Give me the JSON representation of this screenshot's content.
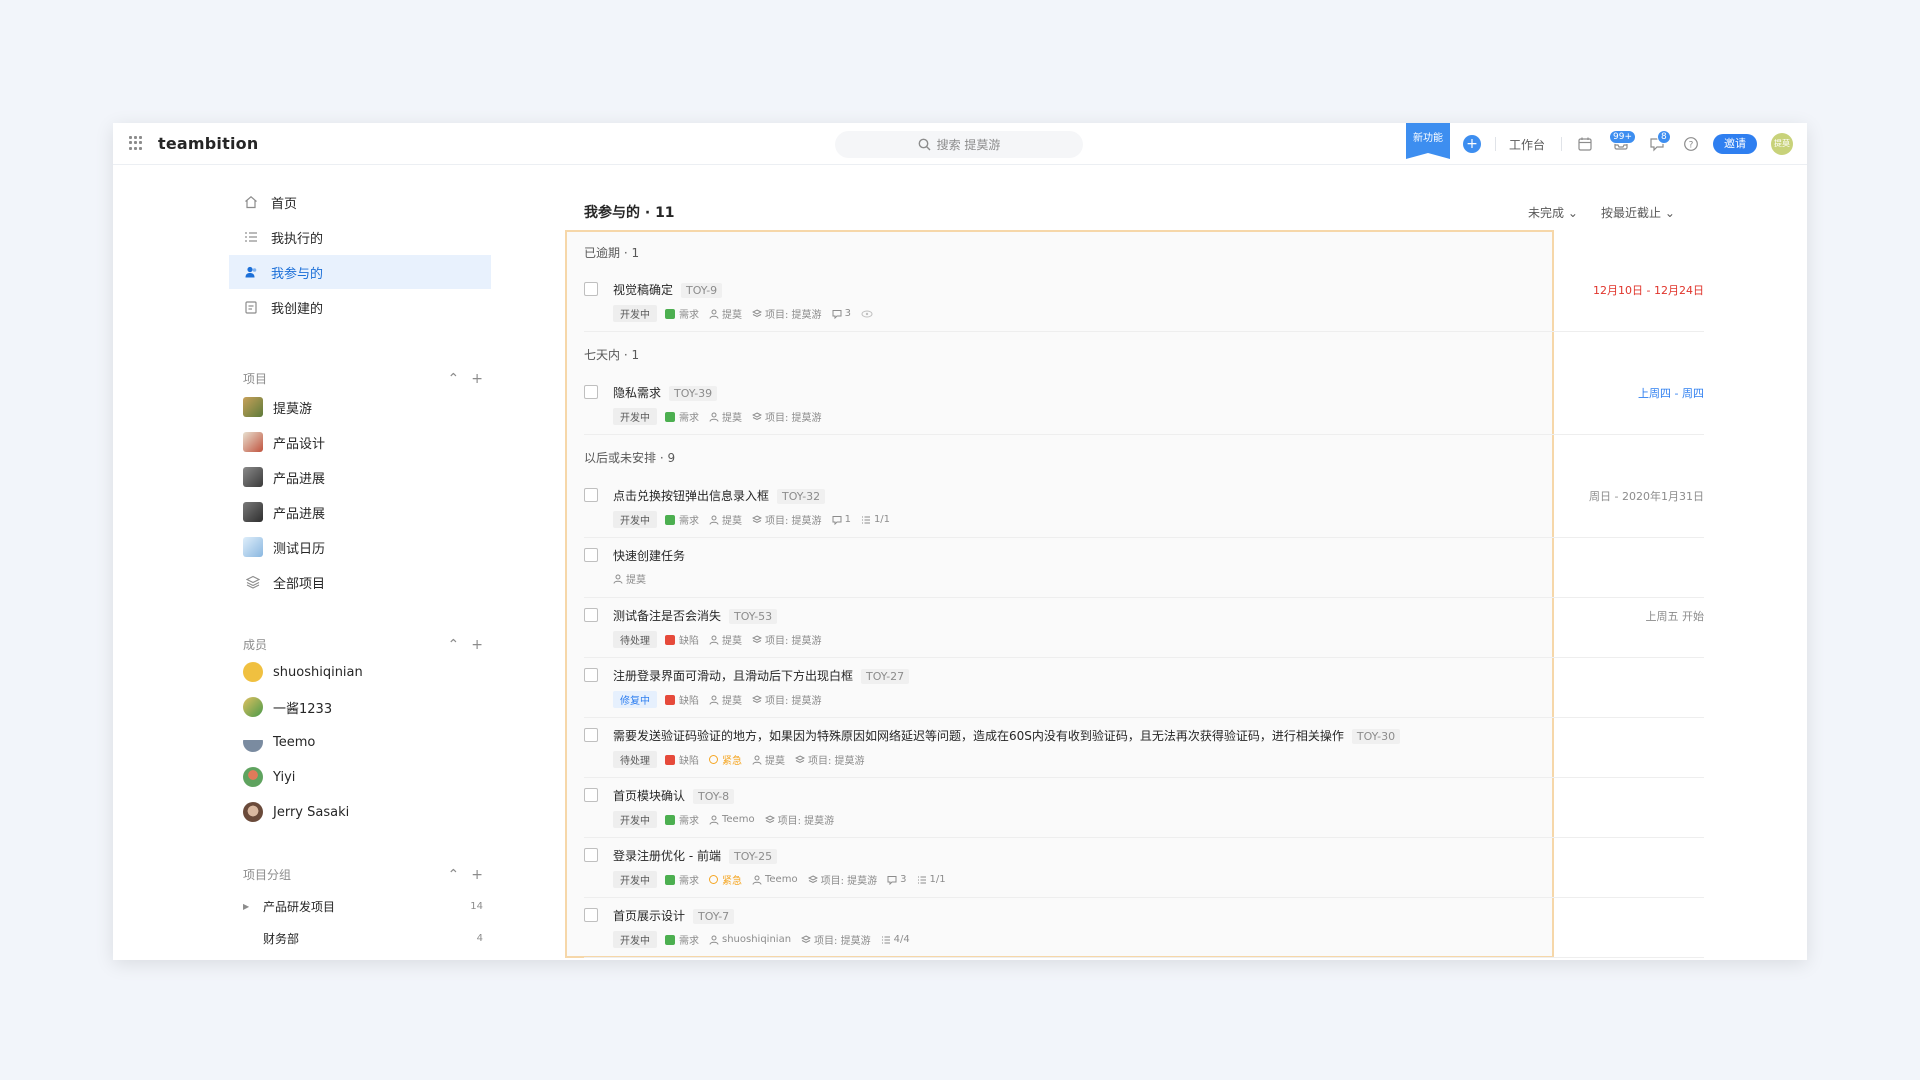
{
  "app": {
    "logo": "teambition",
    "search_placeholder": "搜索 提莫游",
    "new_feature": "新功能",
    "workbench": "工作台",
    "notif_badge": "99+",
    "msg_badge": "8",
    "invite": "邀请",
    "user_initials": "提莫"
  },
  "sidebar": {
    "nav": [
      {
        "label": "首页",
        "icon": "home-icon"
      },
      {
        "label": "我执行的",
        "icon": "list-icon"
      },
      {
        "label": "我参与的",
        "icon": "participant-icon",
        "active": true
      },
      {
        "label": "我创建的",
        "icon": "created-icon"
      }
    ],
    "projects_header": "项目",
    "projects": [
      {
        "label": "提莫游",
        "color": "#8a6d3b"
      },
      {
        "label": "产品设计",
        "color": "#c0533e"
      },
      {
        "label": "产品进展",
        "color": "#5b5b5b"
      },
      {
        "label": "产品进展",
        "color": "#4a4a4a"
      },
      {
        "label": "测试日历",
        "color": "#9fc5e8"
      },
      {
        "label": "全部项目",
        "color": ""
      }
    ],
    "members_header": "成员",
    "members": [
      {
        "label": "shuoshiqinian",
        "color": "#f0c040"
      },
      {
        "label": "一酱1233",
        "color": "#7cb36b"
      },
      {
        "label": "Teemo",
        "color": "#7a8ba0"
      },
      {
        "label": "Yiyi",
        "color": "#5fa35f"
      },
      {
        "label": "Jerry Sasaki",
        "color": "#8c6a5a"
      }
    ],
    "groups_header": "项目分组",
    "groups": [
      {
        "label": "产品研发项目",
        "count": "14"
      },
      {
        "label": "财务部",
        "count": "4"
      }
    ]
  },
  "main": {
    "title": "我参与的 · 11",
    "filter_status": "未完成",
    "filter_sort": "按最近截止",
    "groups": [
      {
        "label": "已逾期 · 1"
      },
      {
        "label": "七天内 · 1"
      },
      {
        "label": "以后或未安排 · 9"
      }
    ],
    "tasks": [
      {
        "title": "视觉稿确定",
        "id": "TOY-9",
        "status": "开发中",
        "type": "需求",
        "assignee": "提莫",
        "project": "项目: 提莫游",
        "comments": "3",
        "date": "12月10日 - 12月24日"
      },
      {
        "title": "隐私需求",
        "id": "TOY-39",
        "status": "开发中",
        "type": "需求",
        "assignee": "提莫",
        "project": "项目: 提莫游",
        "date": "上周四 - 周四"
      },
      {
        "title": "点击兑换按钮弹出信息录入框",
        "id": "TOY-32",
        "status": "开发中",
        "type": "需求",
        "assignee": "提莫",
        "project": "项目: 提莫游",
        "comments": "1",
        "subtasks": "1/1",
        "date": "周日 - 2020年1月31日"
      },
      {
        "title": "快速创建任务",
        "assignee": "提莫"
      },
      {
        "title": "测试备注是否会消失",
        "id": "TOY-53",
        "status": "待处理",
        "type": "缺陷",
        "assignee": "提莫",
        "project": "项目: 提莫游",
        "date": "上周五 开始"
      },
      {
        "title": "注册登录界面可滑动，且滑动后下方出现白框",
        "id": "TOY-27",
        "status": "修复中",
        "type": "缺陷",
        "assignee": "提莫",
        "project": "项目: 提莫游"
      },
      {
        "title": "需要发送验证码验证的地方，如果因为特殊原因如网络延迟等问题，造成在60S内没有收到验证码，且无法再次获得验证码，进行相关操作",
        "id": "TOY-30",
        "status": "待处理",
        "type": "缺陷",
        "priority": "紧急",
        "assignee": "提莫",
        "project": "项目: 提莫游"
      },
      {
        "title": "首页模块确认",
        "id": "TOY-8",
        "status": "开发中",
        "type": "需求",
        "assignee": "Teemo",
        "project": "项目: 提莫游"
      },
      {
        "title": "登录注册优化 - 前端",
        "id": "TOY-25",
        "status": "开发中",
        "type": "需求",
        "priority": "紧急",
        "assignee": "Teemo",
        "project": "项目: 提莫游",
        "comments": "3",
        "subtasks": "1/1"
      },
      {
        "title": "首页展示设计",
        "id": "TOY-7",
        "status": "开发中",
        "type": "需求",
        "assignee": "shuoshiqinian",
        "project": "项目: 提莫游",
        "subtasks": "4/4"
      }
    ]
  }
}
